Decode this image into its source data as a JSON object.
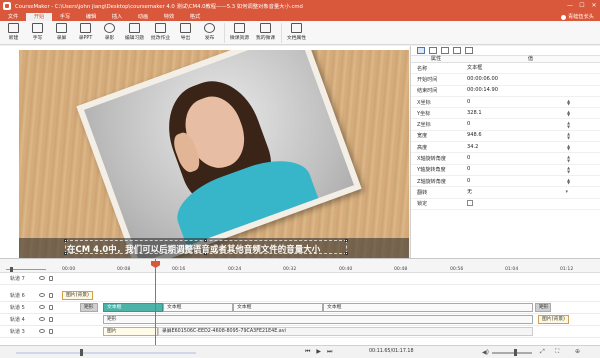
{
  "window": {
    "title": "CourseMaker - C:\\Users\\john jiang\\Desktop\\coursemaker 4.0 测试\\CM4.0教程——5.3 如何调整对象音量大小.cmd",
    "min": "—",
    "max": "☐",
    "close": "✕"
  },
  "menu": {
    "tabs": [
      "文件",
      "开始",
      "手写",
      "编辑",
      "插入",
      "动画",
      "特效",
      "格式"
    ],
    "user": "青蛙伍长头"
  },
  "ribbon": {
    "buttons": [
      "新建",
      "手写",
      "录屏",
      "录PPT",
      "录影",
      "编辑习题",
      "批改作业",
      "导出",
      "发布",
      "微课资源",
      "我的微课",
      "文档属性"
    ]
  },
  "canvas": {
    "caption": "在CM 4.0中，我们可以后期调整语音或者其他音频文件的音量大小"
  },
  "props": {
    "header": {
      "name": "属性",
      "value": "值"
    },
    "rows": [
      {
        "k": "名称",
        "v": "文本框"
      },
      {
        "k": "开始时间",
        "v": "00:00:06.00"
      },
      {
        "k": "结束时间",
        "v": "00:00:14.90"
      },
      {
        "k": "X坐标",
        "v": "0"
      },
      {
        "k": "Y坐标",
        "v": "328.1"
      },
      {
        "k": "Z坐标",
        "v": "0"
      },
      {
        "k": "宽度",
        "v": "948.6"
      },
      {
        "k": "高度",
        "v": "34.2"
      },
      {
        "k": "X轴旋转角度",
        "v": "0"
      },
      {
        "k": "Y轴旋转角度",
        "v": "0"
      },
      {
        "k": "Z轴旋转角度",
        "v": "0"
      },
      {
        "k": "翻转",
        "v": "无"
      },
      {
        "k": "锁定",
        "v": ""
      }
    ]
  },
  "timeline": {
    "ticks": [
      "00:00",
      "00:08",
      "00:16",
      "00:24",
      "00:32",
      "00:40",
      "00:48",
      "00:56",
      "01:04",
      "01:12"
    ],
    "tracks": [
      "轨道 7",
      "轨道 6",
      "轨道 5",
      "轨道 4",
      "轨道 3"
    ],
    "clips": {
      "image_tag": "图片(背景)",
      "rect": "矩形",
      "text1": "文本框",
      "text2": "文本框",
      "text3": "文本框",
      "text4": "文本框",
      "rect2": "矩形",
      "shape": "矩形",
      "image_tag2": "图片(背景)",
      "img": "图片",
      "audio": "录屏E601506C-EED2-4608-8095-79CA3FE21E4E.avi"
    }
  },
  "playbar": {
    "time": "00:11.65/01:17.18",
    "prev": "⏮",
    "play": "▶",
    "next": "⏭",
    "vol": "◀)",
    "fullscreen": "⤢",
    "fit": "⛶",
    "zoom": "⊕"
  }
}
